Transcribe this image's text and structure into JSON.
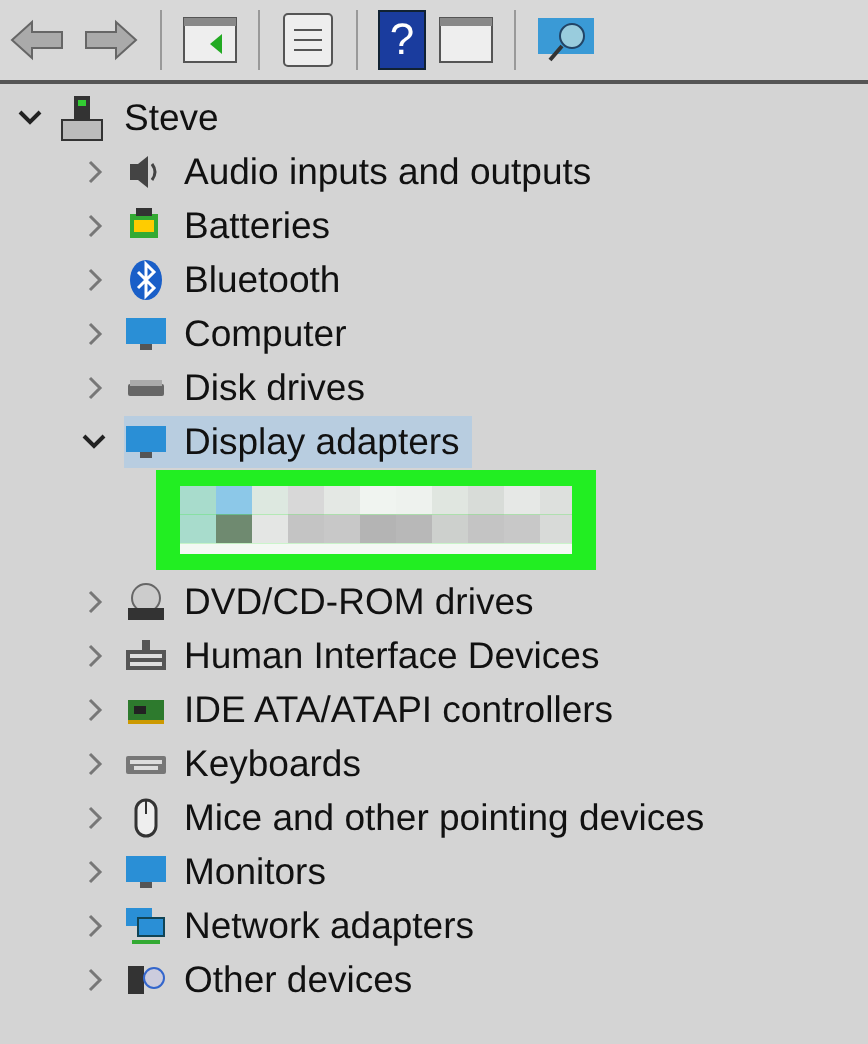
{
  "toolbar": {
    "help_glyph": "?"
  },
  "tree": {
    "label": "Steve",
    "expanded": true,
    "children": [
      {
        "label": "Audio inputs and outputs",
        "expanded": false,
        "selected": false
      },
      {
        "label": "Batteries",
        "expanded": false,
        "selected": false
      },
      {
        "label": "Bluetooth",
        "expanded": false,
        "selected": false
      },
      {
        "label": "Computer",
        "expanded": false,
        "selected": false
      },
      {
        "label": "Disk drives",
        "expanded": false,
        "selected": false
      },
      {
        "label": "Display adapters",
        "expanded": true,
        "selected": true,
        "children": [
          {
            "kind": "redacted"
          }
        ]
      },
      {
        "label": "DVD/CD-ROM drives",
        "expanded": false,
        "selected": false
      },
      {
        "label": "Human Interface Devices",
        "expanded": false,
        "selected": false
      },
      {
        "label": "IDE ATA/ATAPI controllers",
        "expanded": false,
        "selected": false
      },
      {
        "label": "Keyboards",
        "expanded": false,
        "selected": false
      },
      {
        "label": "Mice and other pointing devices",
        "expanded": false,
        "selected": false
      },
      {
        "label": "Monitors",
        "expanded": false,
        "selected": false
      },
      {
        "label": "Network adapters",
        "expanded": false,
        "selected": false
      },
      {
        "label": "Other devices",
        "expanded": false,
        "selected": false
      }
    ]
  }
}
